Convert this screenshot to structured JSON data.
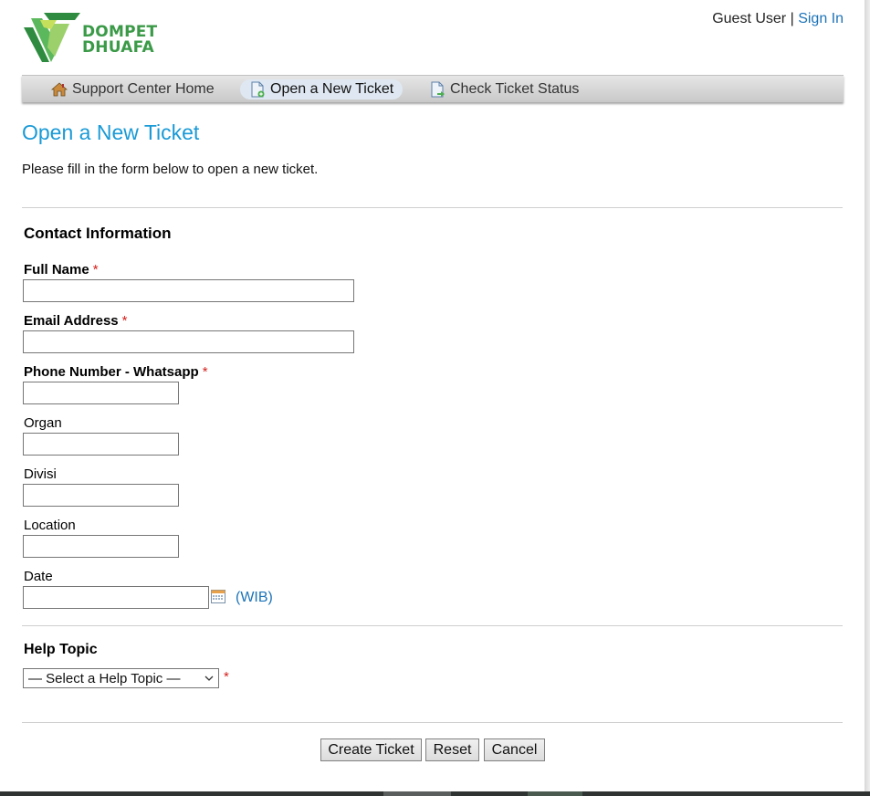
{
  "brand": {
    "line1": "DOMPET",
    "line2": "DHUAFA"
  },
  "user": {
    "guest_label": "Guest User",
    "separator": "|",
    "sign_in": "Sign In"
  },
  "nav": {
    "home": "Support Center Home",
    "new_ticket": "Open a New Ticket",
    "status": "Check Ticket Status"
  },
  "page": {
    "title": "Open a New Ticket",
    "intro": "Please fill in the form below to open a new ticket."
  },
  "contact": {
    "heading": "Contact Information",
    "full_name": {
      "label": "Full Name",
      "required": "*",
      "value": ""
    },
    "email": {
      "label": "Email Address",
      "required": "*",
      "value": ""
    },
    "phone": {
      "label": "Phone Number - Whatsapp",
      "required": "*",
      "value": ""
    },
    "organ": {
      "label": "Organ",
      "value": ""
    },
    "divisi": {
      "label": "Divisi",
      "value": ""
    },
    "location": {
      "label": "Location",
      "value": ""
    },
    "date": {
      "label": "Date",
      "value": "",
      "timezone": "(WIB)"
    }
  },
  "help_topic": {
    "heading": "Help Topic",
    "selected": "— Select a Help Topic —",
    "required": "*"
  },
  "buttons": {
    "create": "Create Ticket",
    "reset": "Reset",
    "cancel": "Cancel"
  },
  "colors": {
    "link": "#1d73b8",
    "title": "#1a9ad6",
    "required": "#d3211d",
    "brand_green": "#3b9a48"
  },
  "icons": {
    "home": "home-icon",
    "new_ticket": "new-ticket-icon",
    "status": "ticket-status-icon",
    "calendar": "calendar-icon"
  }
}
